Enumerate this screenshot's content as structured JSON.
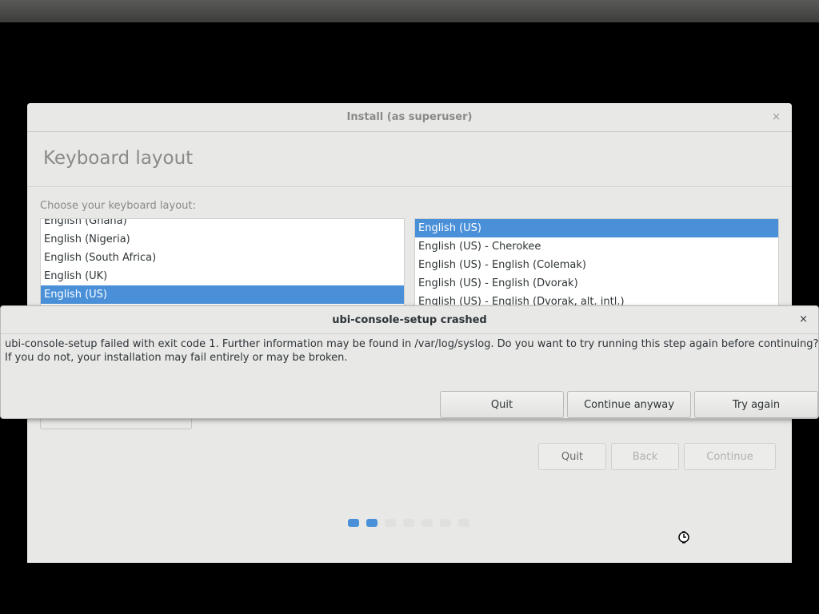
{
  "installer": {
    "title": "Install (as superuser)",
    "close_glyph": "×",
    "heading": "Keyboard layout",
    "choose_label": "Choose your keyboard layout:",
    "layouts": [
      {
        "label": "English (Ghana)",
        "selected": false
      },
      {
        "label": "English (Nigeria)",
        "selected": false
      },
      {
        "label": "English (South Africa)",
        "selected": false
      },
      {
        "label": "English (UK)",
        "selected": false
      },
      {
        "label": "English (US)",
        "selected": true
      }
    ],
    "variants": [
      {
        "label": "English (US)",
        "selected": true
      },
      {
        "label": "English (US) - Cherokee",
        "selected": false
      },
      {
        "label": "English (US) - English (Colemak)",
        "selected": false
      },
      {
        "label": "English (US) - English (Dvorak)",
        "selected": false
      },
      {
        "label": "English (US) - English (Dvorak, alt. intl.)",
        "selected": false
      }
    ],
    "buttons": {
      "quit": "Quit",
      "back": "Back",
      "continue": "Continue"
    },
    "progress": {
      "total_steps": 7,
      "active_steps": 2
    }
  },
  "crash_dialog": {
    "title": "ubi-console-setup crashed",
    "close_glyph": "×",
    "message_line1": "ubi-console-setup failed with exit code 1. Further information may be found in /var/log/syslog. Do you want to try running this step again before continuing?",
    "message_line2": "If you do not, your installation may fail entirely or may be broken.",
    "buttons": {
      "quit": "Quit",
      "continue_anyway": "Continue anyway",
      "try_again": "Try again"
    }
  },
  "colors": {
    "accent": "#4a90d9",
    "background": "#000000",
    "window": "#e8e8e7"
  },
  "icons": {
    "cursor": "busy-cursor-icon"
  }
}
